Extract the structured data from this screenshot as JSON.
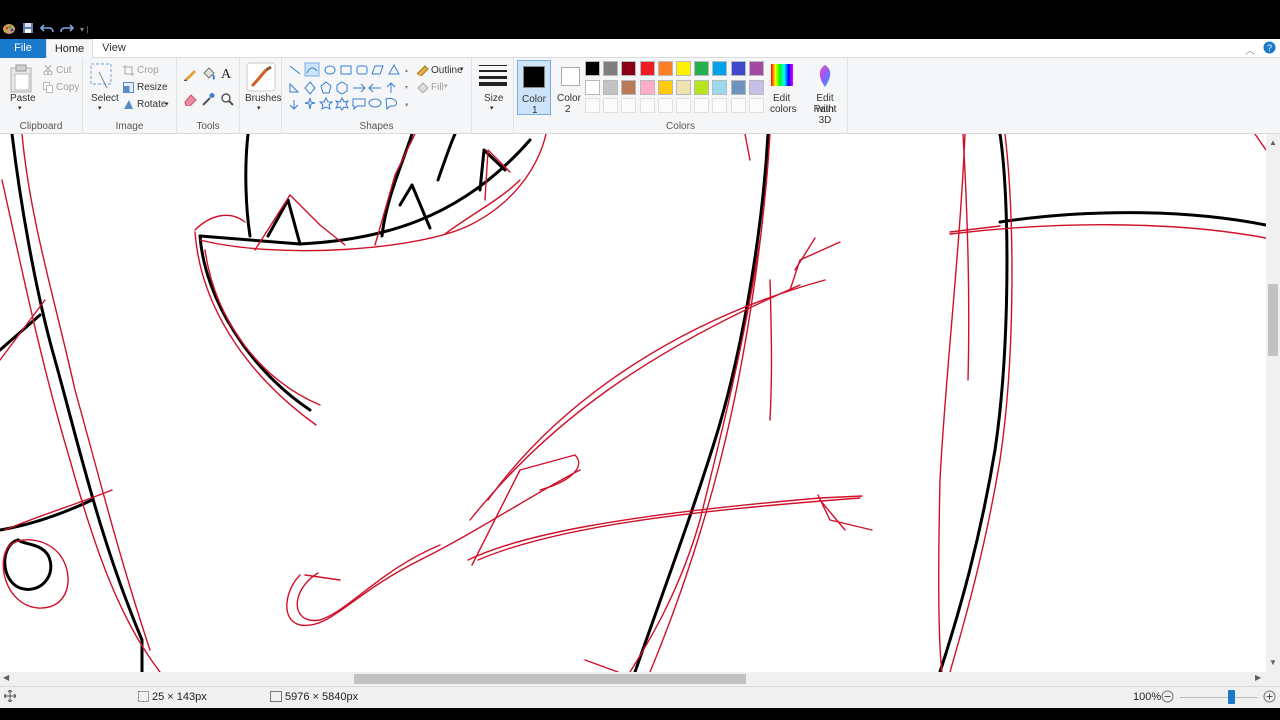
{
  "titlebar": {
    "quick_access": [
      "app-icon",
      "save-icon",
      "undo-icon",
      "redo-icon",
      "customize-icon"
    ]
  },
  "tabs": {
    "file": "File",
    "home": "Home",
    "view": "View"
  },
  "clipboard": {
    "paste": "Paste",
    "cut": "Cut",
    "copy": "Copy",
    "group": "Clipboard"
  },
  "image": {
    "select": "Select",
    "crop": "Crop",
    "resize": "Resize",
    "rotate": "Rotate",
    "group": "Image"
  },
  "tools": {
    "group": "Tools"
  },
  "brushes": {
    "label": "Brushes"
  },
  "shapes": {
    "outline": "Outline",
    "fill": "Fill",
    "group": "Shapes"
  },
  "size": {
    "label": "Size"
  },
  "colors": {
    "color1_label_a": "Color",
    "color1_label_b": "1",
    "color2_label_a": "Color",
    "color2_label_b": "2",
    "edit_colors_a": "Edit",
    "edit_colors_b": "colors",
    "group": "Colors",
    "color1": "#000000",
    "color2": "#ffffff",
    "row1": [
      "#000000",
      "#7f7f7f",
      "#880015",
      "#ed1c24",
      "#ff7f27",
      "#fff200",
      "#22b14c",
      "#00a2e8",
      "#3f48cc",
      "#a349a4"
    ],
    "row2": [
      "#ffffff",
      "#c3c3c3",
      "#b97a57",
      "#ffaec9",
      "#ffc90e",
      "#efe4b0",
      "#b5e61d",
      "#99d9ea",
      "#7092be",
      "#c8bfe7"
    ]
  },
  "paint3d": {
    "a": "Edit with",
    "b": "Paint 3D"
  },
  "status": {
    "selection": "25 × 143px",
    "image_size": "5976 × 5840px",
    "zoom": "100%"
  },
  "zoom_level": 0.66
}
